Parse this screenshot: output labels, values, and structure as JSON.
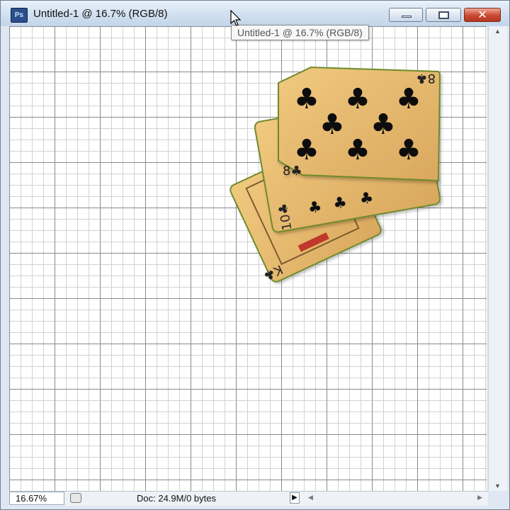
{
  "window": {
    "app_icon": "Ps",
    "title": "Untitled-1 @ 16.7% (RGB/8)",
    "controls": [
      "minimize",
      "maximize",
      "close"
    ],
    "close_glyph": "✕"
  },
  "tooltip": {
    "text": "Untitled-1 @ 16.7% (RGB/8)"
  },
  "canvas": {
    "grid": true,
    "grid_color": "#8a8a8a",
    "subgrid_color": "#d2d2d2",
    "content": {
      "cards": [
        {
          "rank": "K",
          "suit": "clubs",
          "rank_suit_label": "K♣"
        },
        {
          "rank": "10",
          "suit": "clubs",
          "rank_suit_label": "10♣"
        },
        {
          "rank": "8",
          "suit": "clubs",
          "rank_suit_label": "8♣"
        }
      ],
      "card_color": "#e6b86f",
      "card_outline_color": "#6f8a2a",
      "pip_glyph": "♣"
    }
  },
  "status": {
    "zoom": "16.67%",
    "doc_info": "Doc: 24.9M/0 bytes",
    "play_glyph": "▶"
  },
  "icons": {
    "scroll_up": "▲",
    "scroll_down": "▼",
    "scroll_left": "◀",
    "scroll_right": "▶"
  }
}
